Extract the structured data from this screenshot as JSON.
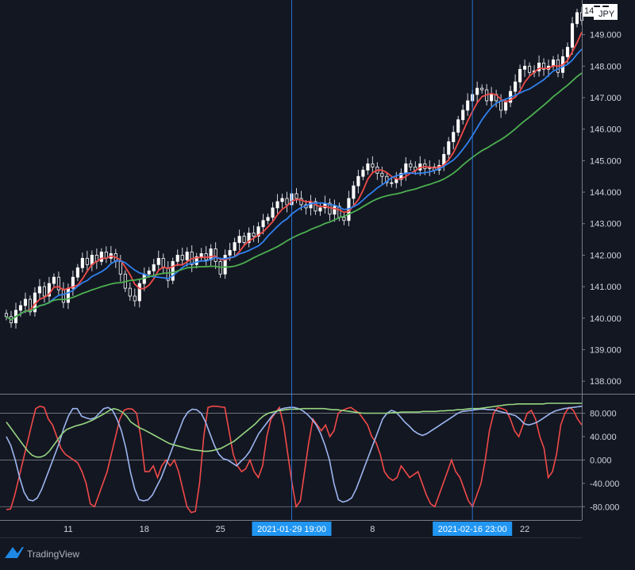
{
  "chart_data": [
    {
      "type": "candlestick",
      "symbol_suffix": "JPY",
      "last_price_label": "14█.█5",
      "ylim": [
        137.6,
        150.1
      ],
      "yticks": [
        "138.000",
        "139.000",
        "140.000",
        "141.000",
        "142.000",
        "143.000",
        "144.000",
        "145.000",
        "146.000",
        "147.000",
        "148.000",
        "149.000"
      ],
      "ytick_values": [
        138,
        139,
        140,
        141,
        142,
        143,
        144,
        145,
        146,
        147,
        148,
        149
      ],
      "x_ticks": [
        "11",
        "18",
        "25",
        "8",
        "22"
      ],
      "x_tick_index": [
        13,
        29,
        45,
        77,
        109
      ],
      "crosshair_labels": [
        "2021-01-29  19:00",
        "2021-02-16  23:00"
      ],
      "crosshair_index": [
        60,
        98
      ],
      "close": [
        140.05,
        139.85,
        140.25,
        140.4,
        140.6,
        140.2,
        140.8,
        141.0,
        140.7,
        141.1,
        141.3,
        140.9,
        140.5,
        140.95,
        141.3,
        141.6,
        141.9,
        141.7,
        142.0,
        141.8,
        142.1,
        141.9,
        142.05,
        141.8,
        141.4,
        140.95,
        140.7,
        140.55,
        141.1,
        141.4,
        141.5,
        141.7,
        141.9,
        141.6,
        141.2,
        141.8,
        142.0,
        141.85,
        142.1,
        141.7,
        141.95,
        142.05,
        141.85,
        142.2,
        141.8,
        141.4,
        142.0,
        142.15,
        142.4,
        142.6,
        142.4,
        142.7,
        142.6,
        142.9,
        143.1,
        143.2,
        143.5,
        143.7,
        143.8,
        143.6,
        143.95,
        143.8,
        143.6,
        143.5,
        143.7,
        143.4,
        143.5,
        143.65,
        143.3,
        143.55,
        143.2,
        143.1,
        143.8,
        144.2,
        144.5,
        144.7,
        144.9,
        144.8,
        144.6,
        144.5,
        144.3,
        144.3,
        144.4,
        144.6,
        144.9,
        144.8,
        144.7,
        144.9,
        144.75,
        144.8,
        144.7,
        144.85,
        145.2,
        145.6,
        145.9,
        146.3,
        146.6,
        146.9,
        147.1,
        147.3,
        147.25,
        146.9,
        147.1,
        146.9,
        146.6,
        146.85,
        147.2,
        147.5,
        147.9,
        148.0,
        147.8,
        147.85,
        148.1,
        147.9,
        148.0,
        148.2,
        147.8,
        148.3,
        148.6,
        149.35,
        149.7,
        149.45
      ],
      "overlays": [
        {
          "name": "",
          "color": "#f04a48",
          "period": 5
        },
        {
          "name": "",
          "color": "#2f80ed",
          "period": 10
        },
        {
          "name": "",
          "color": "#4caf50",
          "period": 25
        }
      ]
    },
    {
      "type": "line",
      "ylim": [
        -100,
        112
      ],
      "yticks": [
        "80.000",
        "40.000",
        "0.000",
        "-40.000",
        "-80.000"
      ],
      "ytick_values": [
        80,
        40,
        0,
        -40,
        -80
      ],
      "reference_lines": [
        80,
        0,
        -80
      ],
      "series": [
        {
          "name": "",
          "color": "#f04a48",
          "values": [
            -85,
            -84,
            -60,
            -30,
            0,
            30,
            60,
            88,
            92,
            90,
            70,
            60,
            40,
            20,
            10,
            5,
            0,
            -5,
            -20,
            -40,
            -75,
            -80,
            -60,
            -40,
            -20,
            10,
            40,
            70,
            85,
            88,
            87,
            80,
            40,
            -20,
            -20,
            -10,
            -30,
            -10,
            0,
            -10,
            0,
            -20,
            -50,
            -80,
            -90,
            -88,
            -40,
            40,
            90,
            92,
            92,
            91,
            90,
            50,
            10,
            -10,
            -20,
            -15,
            0,
            -20,
            -30,
            -10,
            40,
            70,
            80,
            90,
            60,
            10,
            -40,
            -80,
            -70,
            -20,
            30,
            70,
            60,
            50,
            60,
            40,
            50,
            80,
            85,
            88,
            90,
            85,
            80,
            70,
            60,
            40,
            30,
            10,
            -20,
            -30,
            -35,
            -30,
            -10,
            -20,
            -30,
            -25,
            -20,
            -40,
            -60,
            -75,
            -80,
            -60,
            -40,
            -20,
            0,
            -20,
            -30,
            -50,
            -70,
            -80,
            -60,
            -40,
            0,
            50,
            80,
            90,
            88,
            85,
            70,
            50,
            40,
            60,
            80,
            85,
            70,
            40,
            20,
            -30,
            -20,
            10,
            60,
            80,
            90,
            85,
            70,
            60
          ]
        },
        {
          "name": "",
          "color": "#9db6f0",
          "values": [
            40,
            25,
            0,
            -30,
            -55,
            -68,
            -70,
            -65,
            -50,
            -30,
            -10,
            10,
            30,
            55,
            75,
            88,
            88,
            75,
            72,
            70,
            72,
            80,
            88,
            90,
            85,
            70,
            50,
            20,
            -20,
            -50,
            -68,
            -70,
            -68,
            -60,
            -45,
            -30,
            -10,
            10,
            30,
            50,
            70,
            82,
            87,
            86,
            80,
            65,
            45,
            25,
            10,
            2,
            0,
            -5,
            -10,
            -2,
            5,
            15,
            30,
            45,
            55,
            65,
            75,
            83,
            87,
            89,
            90,
            90,
            88,
            84,
            78,
            70,
            60,
            45,
            25,
            0,
            -40,
            -68,
            -72,
            -70,
            -65,
            -50,
            -30,
            -10,
            10,
            30,
            50,
            70,
            80,
            85,
            82,
            74,
            65,
            58,
            50,
            45,
            42,
            45,
            50,
            55,
            60,
            65,
            70,
            75,
            80,
            83,
            84,
            85,
            86,
            87,
            87,
            86,
            86,
            84,
            82,
            80,
            78,
            76,
            70,
            62,
            60,
            62,
            65,
            70,
            75,
            80,
            84,
            86,
            88,
            89,
            90,
            91,
            92
          ]
        },
        {
          "name": "",
          "color": "#98d682",
          "values": [
            65,
            55,
            45,
            35,
            25,
            15,
            8,
            5,
            5,
            8,
            15,
            25,
            35,
            45,
            52,
            55,
            58,
            60,
            62,
            65,
            68,
            72,
            76,
            80,
            85,
            88,
            86,
            82,
            75,
            65,
            60,
            55,
            52,
            48,
            44,
            40,
            36,
            32,
            28,
            26,
            24,
            22,
            20,
            18,
            17,
            16,
            15,
            15,
            16,
            18,
            20,
            24,
            28,
            32,
            38,
            44,
            50,
            56,
            62,
            70,
            76,
            80,
            82,
            84,
            85,
            86,
            87,
            87,
            87,
            88,
            88,
            88,
            88,
            88,
            88,
            87,
            86,
            86,
            85,
            84,
            83,
            82,
            81,
            80,
            80,
            80,
            80,
            80,
            80,
            80,
            81,
            81,
            82,
            82,
            82,
            82,
            82,
            83,
            83,
            83,
            83,
            84,
            84,
            85,
            85,
            86,
            86,
            87,
            88,
            88,
            88,
            89,
            90,
            91,
            92,
            93,
            94,
            95,
            95,
            96,
            96,
            96,
            96,
            96,
            96,
            96,
            97,
            97,
            97,
            97,
            97,
            97,
            97,
            97,
            97
          ]
        }
      ]
    }
  ],
  "branding": {
    "logo_text": "TradingView"
  }
}
